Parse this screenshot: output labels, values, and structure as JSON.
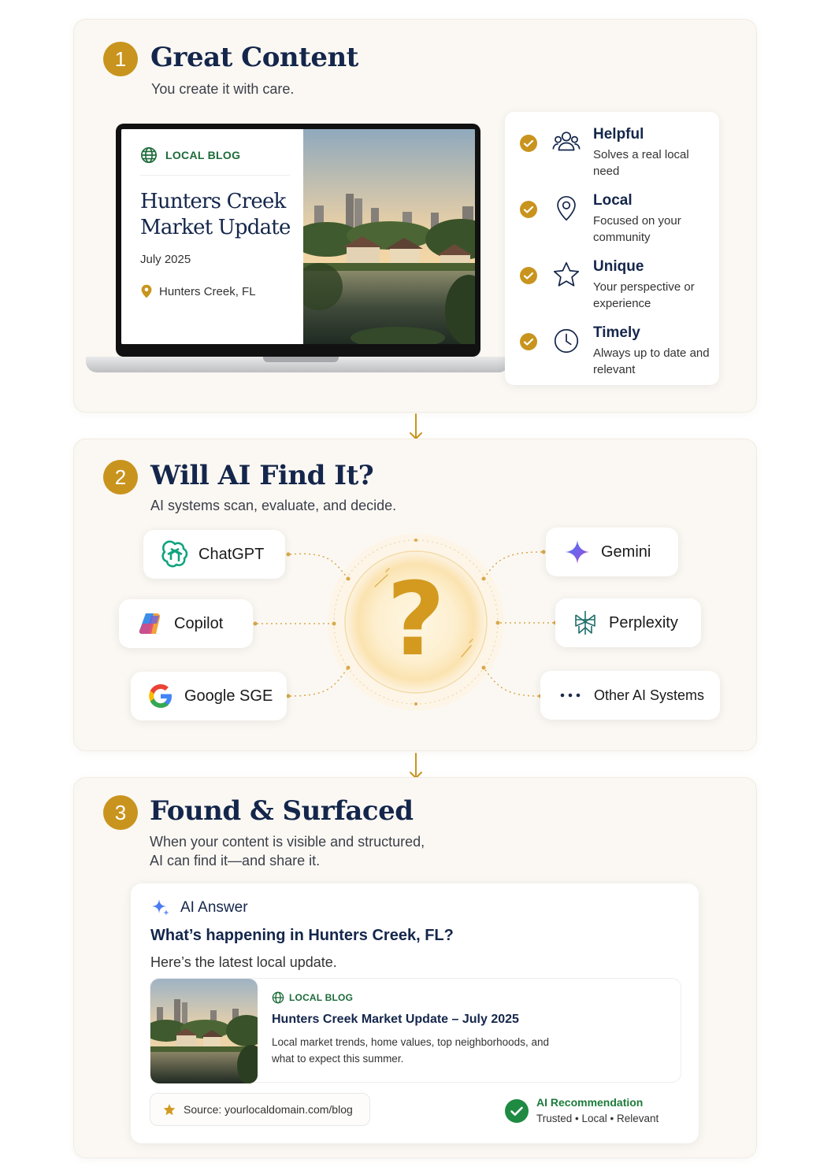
{
  "step1": {
    "number": "1",
    "title": "Great Content",
    "subtitle": "You create it with care.",
    "blog": {
      "tag": "LOCAL BLOG",
      "title": "Hunters Creek Market Update",
      "date": "July 2025",
      "location": "Hunters Creek, FL"
    },
    "qualities": [
      {
        "icon": "people-icon",
        "title": "Helpful",
        "desc": "Solves a real local need"
      },
      {
        "icon": "location-pin-icon",
        "title": "Local",
        "desc": "Focused on your community"
      },
      {
        "icon": "star-icon",
        "title": "Unique",
        "desc": "Your perspective or experience"
      },
      {
        "icon": "clock-icon",
        "title": "Timely",
        "desc": "Always up to date and relevant"
      }
    ]
  },
  "step2": {
    "number": "2",
    "title": "Will AI Find It?",
    "subtitle": "AI systems scan, evaluate, and decide.",
    "center_symbol": "?",
    "systems": [
      {
        "name": "ChatGPT",
        "icon": "chatgpt-icon"
      },
      {
        "name": "Copilot",
        "icon": "copilot-icon"
      },
      {
        "name": "Google SGE",
        "icon": "google-icon"
      },
      {
        "name": "Gemini",
        "icon": "gemini-icon"
      },
      {
        "name": "Perplexity",
        "icon": "perplexity-icon"
      },
      {
        "name": "Other AI Systems",
        "icon": "more-dots-icon"
      }
    ]
  },
  "step3": {
    "number": "3",
    "title": "Found & Surfaced",
    "subtitle_line1": "When your content is visible and structured,",
    "subtitle_line2": "AI can find it—and share it.",
    "answer": {
      "label": "AI Answer",
      "question": "What’s happening in Hunters Creek, FL?",
      "reply": "Here’s the latest local update.",
      "result": {
        "tag": "LOCAL BLOG",
        "title": "Hunters Creek Market Update – July 2025",
        "desc": "Local market trends, home values, top neighborhoods, and what to expect this summer."
      },
      "source": "Source: yourlocaldomain.com/blog",
      "recommendation_title": "AI Recommendation",
      "recommendation_sub": "Trusted • Local • Relevant"
    }
  },
  "colors": {
    "gold": "#c9941e",
    "navy": "#14264b",
    "green": "#1d6b3a",
    "panel": "#fbf8f3"
  }
}
